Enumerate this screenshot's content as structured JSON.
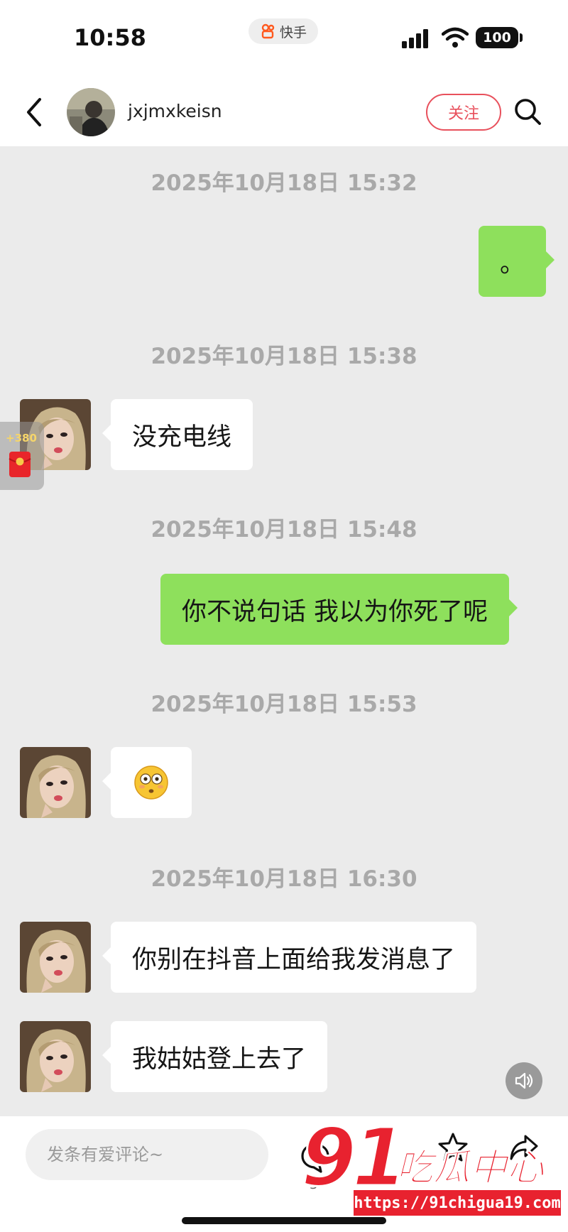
{
  "status_bar": {
    "time": "10:58",
    "app_name": "快手",
    "battery": "100"
  },
  "header": {
    "username": "jxjmxkeisn",
    "follow_label": "关注"
  },
  "messages": [
    {
      "timestamp": "2025年10月18日 15:32",
      "sender": "me",
      "text": "。"
    },
    {
      "timestamp": "2025年10月18日 15:38",
      "sender": "them",
      "text": "没充电线"
    },
    {
      "timestamp": "2025年10月18日 15:48",
      "sender": "me",
      "text": "你不说句话 我以为你死了呢"
    },
    {
      "timestamp": "2025年10月18日 15:53",
      "sender": "them",
      "emoji": "flushed-face-icon"
    },
    {
      "timestamp": "2025年10月18日 16:30",
      "sender": "them",
      "text": "你别在抖音上面给我发消息了"
    },
    {
      "sender": "them",
      "text": "我姑姑登上去了"
    }
  ],
  "reward": {
    "count": "+380"
  },
  "bottom": {
    "comment_placeholder": "发条有爱评论~",
    "like_count": "3"
  },
  "watermark": {
    "number": "91",
    "name": "吃瓜中心",
    "url": "https://91chigua19.com"
  },
  "colors": {
    "outgoing_bubble": "#8ee05c",
    "incoming_bubble": "#ffffff",
    "follow_accent": "#e8505c",
    "watermark_red": "#e8222f"
  }
}
